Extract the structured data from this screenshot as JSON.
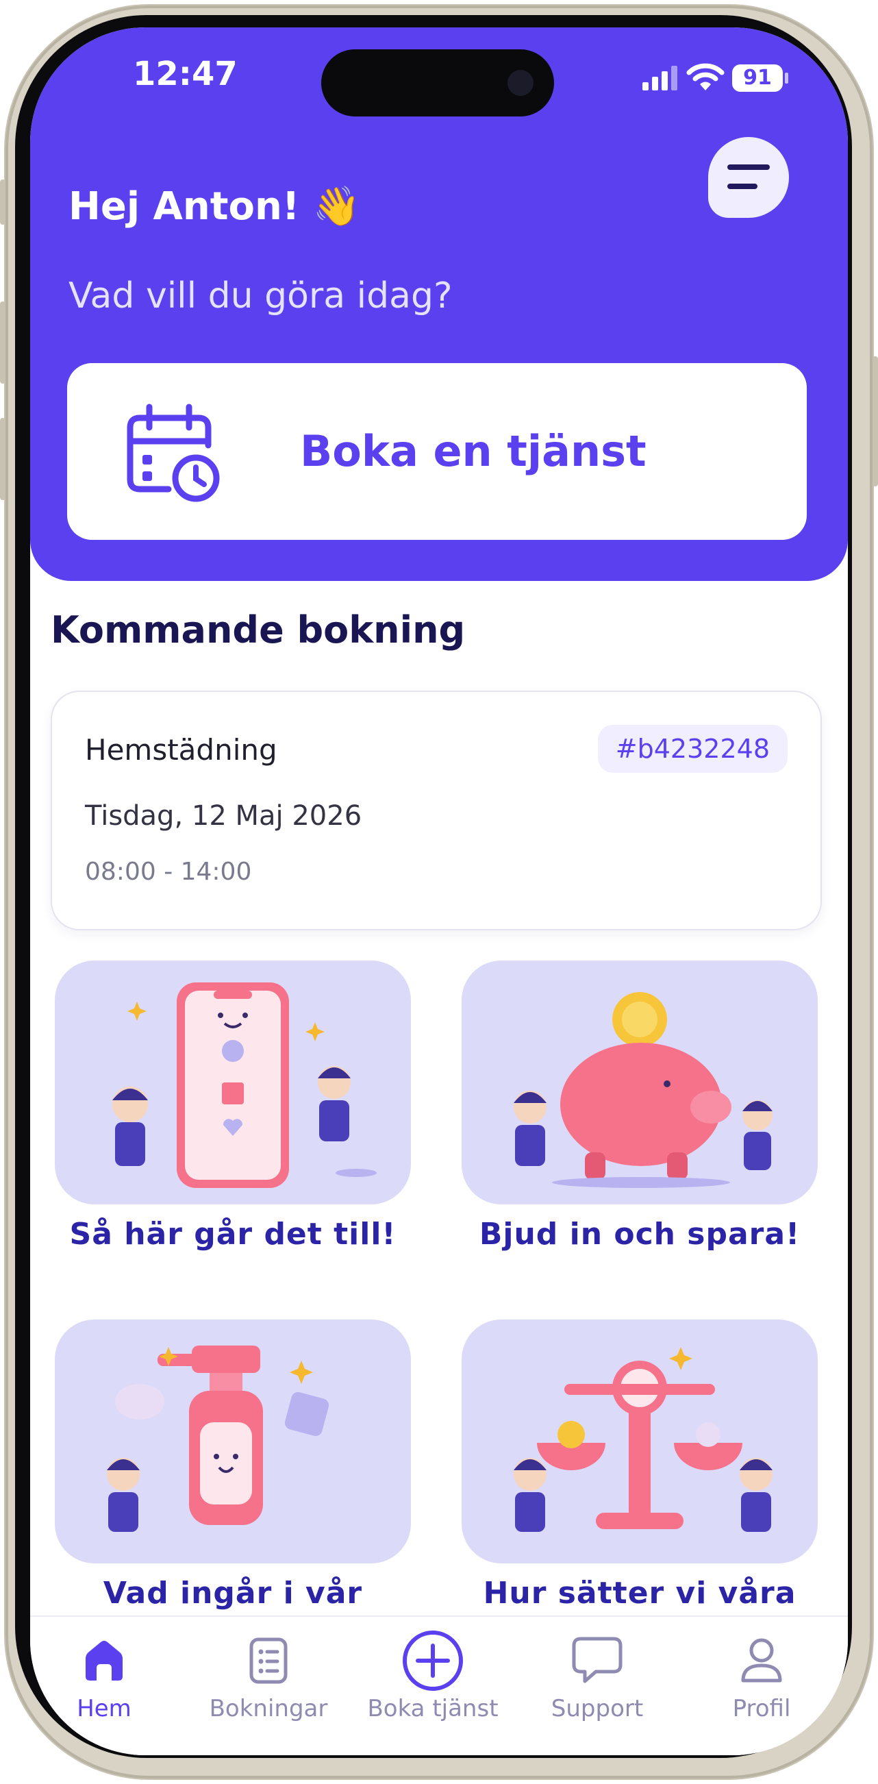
{
  "status_bar": {
    "time": "12:47",
    "battery": "91"
  },
  "header": {
    "greeting": "Hej Anton! 👋",
    "subtitle": "Vad vill du göra idag?",
    "book_button_label": "Boka en tjänst"
  },
  "upcoming": {
    "section_title": "Kommande bokning",
    "service": "Hemstädning",
    "booking_id": "#b4232248",
    "date": "Tisdag, 12 Maj 2026",
    "time": "08:00 - 14:00"
  },
  "tiles": [
    {
      "caption": "Så här går det till!",
      "icon": "phone-steps-illustration"
    },
    {
      "caption": "Bjud in och spara!",
      "icon": "piggy-bank-illustration"
    },
    {
      "caption": "Vad ingår i vår",
      "icon": "cleaning-spray-illustration"
    },
    {
      "caption": "Hur sätter vi våra",
      "icon": "scale-balance-illustration"
    }
  ],
  "tabbar": {
    "items": [
      {
        "label": "Hem",
        "icon": "home-icon",
        "active": true
      },
      {
        "label": "Bokningar",
        "icon": "list-icon",
        "active": false
      },
      {
        "label": "Boka tjänst",
        "icon": "plus-circle-icon",
        "active": false
      },
      {
        "label": "Support",
        "icon": "chat-icon",
        "active": false
      },
      {
        "label": "Profil",
        "icon": "user-icon",
        "active": false
      }
    ]
  },
  "colors": {
    "primary": "#5b40ef",
    "title": "#1a1553",
    "tile_bg": "#dcdaf9",
    "caption": "#2b24a6"
  }
}
